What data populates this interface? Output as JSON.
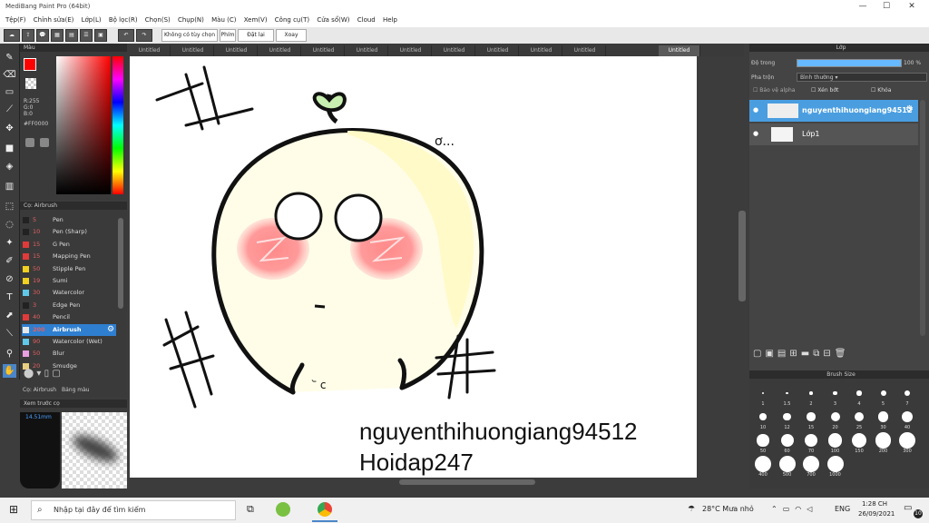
{
  "window": {
    "title": "MediBang Paint Pro (64bit)",
    "minimize": "—",
    "maximize": "☐",
    "close": "✕"
  },
  "menu": [
    "Tệp(F)",
    "Chỉnh sửa(E)",
    "Lớp(L)",
    "Bộ lọc(R)",
    "Chọn(S)",
    "Chụp(N)",
    "Màu (C)",
    "Xem(V)",
    "Công cụ(T)",
    "Cửa sổ(W)",
    "Cloud",
    "Help"
  ],
  "toolbar": {
    "no_selection": "Không có tùy chọn",
    "shortcut": "Phím",
    "reset": "Đặt lại",
    "rotate": "Xoay"
  },
  "tabs": [
    "Untitled",
    "Untitled",
    "Untitled",
    "Untitled",
    "Untitled",
    "Untitled",
    "Untitled",
    "Untitled",
    "Untitled",
    "Untitled",
    "Untitled",
    "Untitled"
  ],
  "color_panel": {
    "title": "Màu",
    "r": "R:255",
    "g": "G:0",
    "b": "B:0",
    "hex": "#FF0000",
    "fg": "#ff0000"
  },
  "brush_panel": {
    "title": "Cọ: Airbrush",
    "items": [
      {
        "size": "5",
        "name": "Pen",
        "color": "#222222"
      },
      {
        "size": "10",
        "name": "Pen (Sharp)",
        "color": "#222222"
      },
      {
        "size": "15",
        "name": "G Pen",
        "color": "#e03a3a"
      },
      {
        "size": "15",
        "name": "Mapping Pen",
        "color": "#e03a3a"
      },
      {
        "size": "50",
        "name": "Stipple Pen",
        "color": "#f0d020"
      },
      {
        "size": "19",
        "name": "Sumi",
        "color": "#f0d020"
      },
      {
        "size": "30",
        "name": "Watercolor",
        "color": "#60c8e8"
      },
      {
        "size": "3",
        "name": "Edge Pen",
        "color": "#222222"
      },
      {
        "size": "40",
        "name": "Pencil",
        "color": "#e03a3a"
      },
      {
        "size": "200",
        "name": "Airbrush",
        "color": "#e8e8e8"
      },
      {
        "size": "90",
        "name": "Watercolor (Wet)",
        "color": "#60c8e8"
      },
      {
        "size": "50",
        "name": "Blur",
        "color": "#e8a0e0"
      },
      {
        "size": "20",
        "name": "Smudge",
        "color": "#e8d080"
      }
    ],
    "tab1": "Cọ: Airbrush",
    "tab2": "Bảng màu"
  },
  "preview": {
    "title": "Xem trước cọ",
    "size": "14.51mm"
  },
  "layer_panel": {
    "title": "Lớp",
    "opacity_label": "Độ trong",
    "opacity": "100 %",
    "blend_label": "Pha trộn",
    "blend": "Bình thường",
    "protect": "Bảo vệ alpha",
    "clip": "Xén bớt",
    "lock": "Khóa",
    "layers": [
      {
        "name": "nguyenthihuongiang94512"
      },
      {
        "name": "Lớp1"
      }
    ]
  },
  "brush_size": {
    "title": "Brush Size",
    "sizes": [
      "1",
      "1.5",
      "2",
      "3",
      "4",
      "5",
      "7",
      "10",
      "12",
      "15",
      "20",
      "25",
      "30",
      "40",
      "50",
      "60",
      "70",
      "100",
      "150",
      "200",
      "300",
      "400",
      "500",
      "700",
      "1000"
    ]
  },
  "canvas": {
    "line1": "nguyenthihuongiang94512",
    "line2": "Hoidap247",
    "thought": "ơ..."
  },
  "taskbar": {
    "search": "Nhập tại đây để tìm kiếm",
    "weather": "28°C Mưa nhỏ",
    "lang": "ENG",
    "time": "1:28 CH",
    "date": "26/09/2021",
    "notif": "10"
  }
}
